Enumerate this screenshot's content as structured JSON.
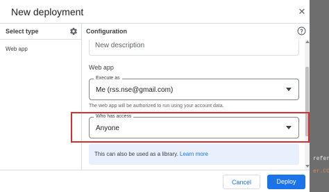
{
  "dialog": {
    "title": "New deployment",
    "close_glyph": "✕"
  },
  "left_pane": {
    "title": "Select type",
    "items": [
      "Web app"
    ]
  },
  "right_pane": {
    "title": "Configuration",
    "description_placeholder": "New description",
    "section_label": "Web app",
    "execute_as": {
      "label": "Execute as",
      "value": "Me (rss.nse@gmail.com)"
    },
    "execute_helper": "The web app will be authorized to run using your account data.",
    "who_has_access": {
      "label": "Who has access",
      "value": "Anyone"
    },
    "info_banner": {
      "text": "This can also be used as a library. ",
      "link": "Learn more"
    }
  },
  "footer": {
    "cancel_label": "Cancel",
    "deploy_label": "Deploy"
  },
  "background_code": {
    "line1": "refer",
    "line2": "er.CO"
  },
  "icons": {
    "settings": "gear-icon",
    "help": "help-icon",
    "close": "close-icon",
    "dropdown": "dropdown-caret-icon"
  },
  "colors": {
    "accent": "#1a73e8",
    "highlight": "#d32f2f",
    "banner_bg": "#e8f0fe"
  }
}
